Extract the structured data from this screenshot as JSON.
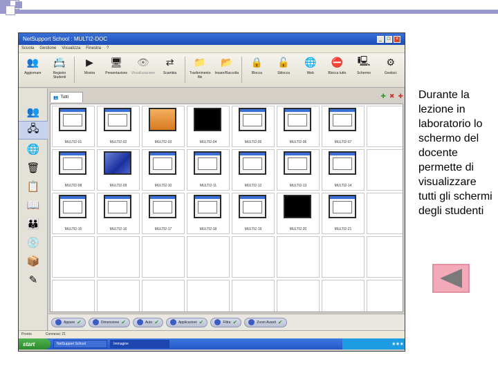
{
  "slide": {
    "caption": "Durante la lezione in laboratorio lo schermo del docente permette di visualizzare tutti gli schermi degli studenti",
    "back_button_icon": "triangle-left-icon",
    "colors": {
      "back_bg": "#f2a9b8",
      "back_arrow": "#7a7a7a",
      "deco_square": "#9999cc"
    }
  },
  "app": {
    "window_title": "NetSupport School : MULTI2-DOC",
    "menu_items": [
      "Scuola",
      "Gestione",
      "Visualizza",
      "Finestra",
      "?"
    ],
    "toolbar": [
      {
        "label": "Aggiornare",
        "icon": "users-icon"
      },
      {
        "label": "Registro Studenti",
        "icon": "register-icon"
      },
      {
        "label": "Mostra",
        "icon": "play-icon"
      },
      {
        "label": "Presentazione",
        "icon": "presentation-icon"
      },
      {
        "label": "Visualizzazione",
        "icon": "view-icon"
      },
      {
        "label": "Scambia",
        "icon": "swap-icon"
      },
      {
        "label": "Trasferimento file",
        "icon": "file-transfer-icon"
      },
      {
        "label": "Invare/Raccolta",
        "icon": "collect-icon"
      },
      {
        "label": "Blocca",
        "icon": "lock-icon"
      },
      {
        "label": "Sblocca",
        "icon": "unlock-icon"
      },
      {
        "label": "Web",
        "icon": "globe-icon"
      },
      {
        "label": "Blocca tutto",
        "icon": "block-icon"
      },
      {
        "label": "Schermo",
        "icon": "monitor-icon"
      },
      {
        "label": "Gestisci",
        "icon": "manage-icon"
      }
    ],
    "tab_label": "Tutti",
    "students": [
      {
        "label": "MULTI2-01",
        "style": "normal"
      },
      {
        "label": "MULTI2-02",
        "style": "normal"
      },
      {
        "label": "MULTI2-03",
        "style": "orange"
      },
      {
        "label": "MULTI2-04",
        "style": "black"
      },
      {
        "label": "MULTI2-05",
        "style": "normal"
      },
      {
        "label": "MULTI2-06",
        "style": "normal"
      },
      {
        "label": "MULTI2-07",
        "style": "normal"
      },
      {
        "label": "",
        "style": "empty"
      },
      {
        "label": "MULTI2-08",
        "style": "normal"
      },
      {
        "label": "MULTI2-09",
        "style": "blue"
      },
      {
        "label": "MULTI2-10",
        "style": "normal"
      },
      {
        "label": "MULTI2-11",
        "style": "normal"
      },
      {
        "label": "MULTI2-12",
        "style": "normal"
      },
      {
        "label": "MULTI2-13",
        "style": "normal"
      },
      {
        "label": "MULTI2-14",
        "style": "normal"
      },
      {
        "label": "",
        "style": "empty"
      },
      {
        "label": "MULTI2-15",
        "style": "normal"
      },
      {
        "label": "MULTI2-16",
        "style": "normal"
      },
      {
        "label": "MULTI2-17",
        "style": "normal"
      },
      {
        "label": "MULTI2-18",
        "style": "normal"
      },
      {
        "label": "MULTI2-19",
        "style": "normal"
      },
      {
        "label": "MULTI2-20",
        "style": "black"
      },
      {
        "label": "MULTI2-21",
        "style": "normal"
      },
      {
        "label": "",
        "style": "empty"
      },
      {
        "label": "",
        "style": "empty"
      },
      {
        "label": "",
        "style": "empty"
      },
      {
        "label": "",
        "style": "empty"
      },
      {
        "label": "",
        "style": "empty"
      },
      {
        "label": "",
        "style": "empty"
      },
      {
        "label": "",
        "style": "empty"
      },
      {
        "label": "",
        "style": "empty"
      },
      {
        "label": "",
        "style": "empty"
      },
      {
        "label": "",
        "style": "empty"
      },
      {
        "label": "",
        "style": "empty"
      },
      {
        "label": "",
        "style": "empty"
      },
      {
        "label": "",
        "style": "empty"
      },
      {
        "label": "",
        "style": "empty"
      },
      {
        "label": "",
        "style": "empty"
      },
      {
        "label": "",
        "style": "empty"
      },
      {
        "label": "",
        "style": "empty"
      }
    ],
    "bottom_buttons": [
      "Appare",
      "Dimensione",
      "Auto",
      "Applicazioni",
      "Filtra",
      "Zoom Avanti"
    ],
    "status": "Connessi: 21",
    "taskbar": {
      "start": "start",
      "tasks": [
        "NetSupport School",
        "Immagine"
      ]
    }
  }
}
